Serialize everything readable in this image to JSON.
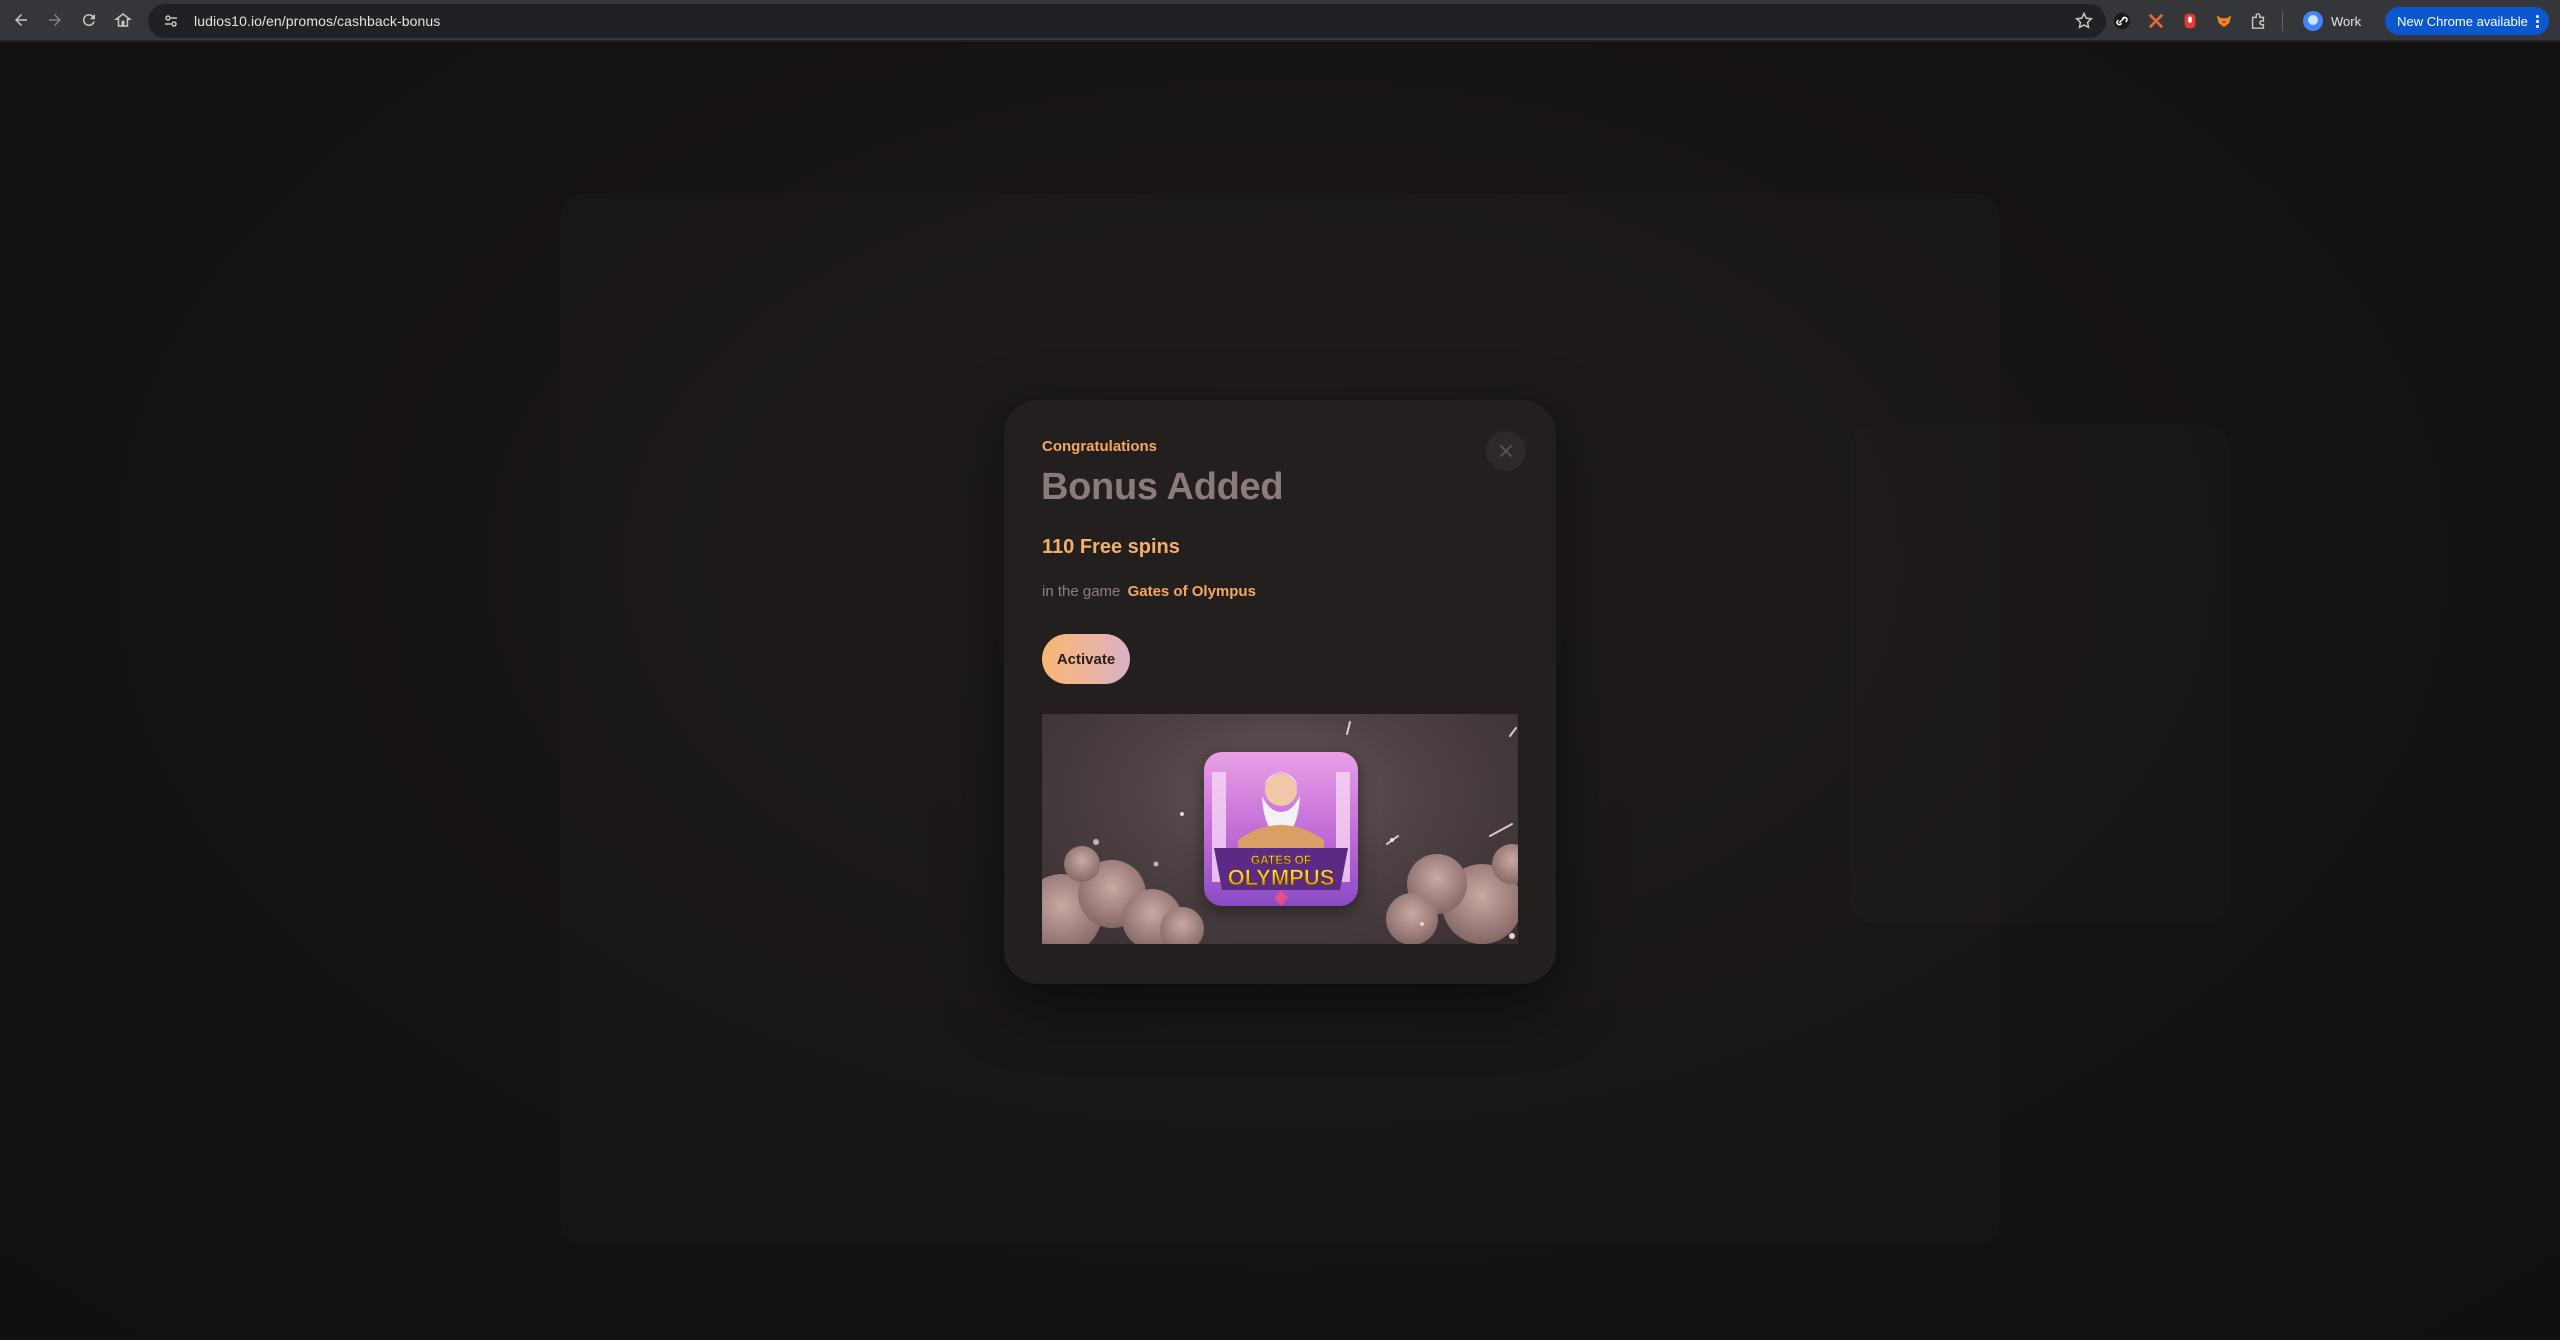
{
  "browser": {
    "url": "ludios10.io/en/promos/cashback-bonus",
    "profile_label": "Work",
    "update_label": "New Chrome available",
    "icons": [
      "back-icon",
      "forward-icon",
      "reload-icon",
      "home-icon",
      "site-info-icon",
      "bookmark-star-icon",
      "link-extension-icon",
      "x-extension-icon",
      "red-extension-icon",
      "fox-extension-icon",
      "puzzle-extensions-icon",
      "kebab-menu-icon"
    ]
  },
  "modal": {
    "eyebrow": "Congratulations",
    "title": "Bonus Added",
    "bonus_amount": "110 Free spins",
    "game_prefix": "in the game",
    "game_name": "Gates of Olympus",
    "activate_label": "Activate",
    "close_icon": "close-icon",
    "tile_text_top": "GATES OF",
    "tile_text_main": "OLYMPUS"
  },
  "colors": {
    "accent": "#f4a862",
    "modal_bg": "#231f1f",
    "overlay_bg": "#141111",
    "title": "#8a7c7a"
  }
}
